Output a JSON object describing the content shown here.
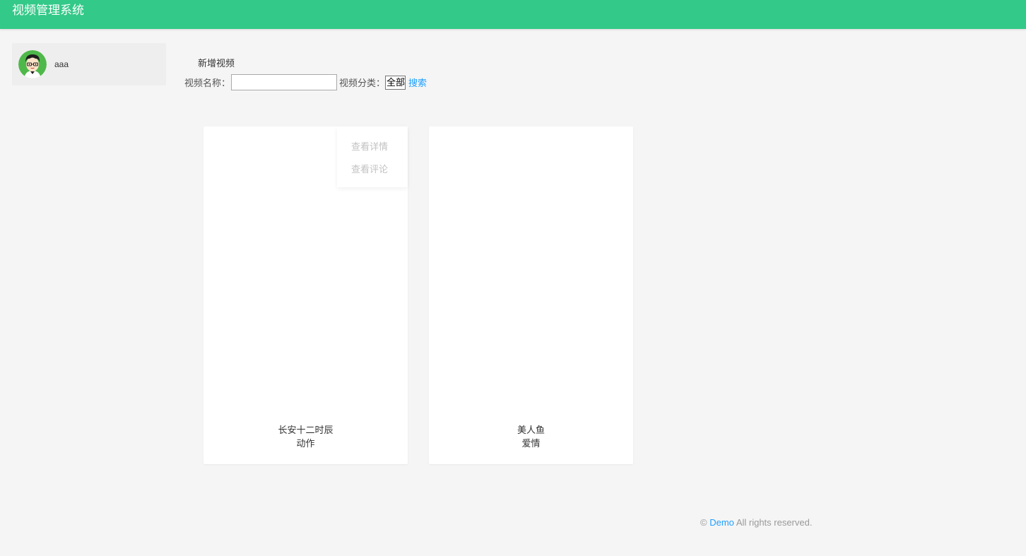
{
  "header": {
    "title": "视频管理系统"
  },
  "user": {
    "name": "aaa",
    "avatar_icon": "cartoon-avatar-icon"
  },
  "toolbar": {
    "add_label": "新增视频",
    "name_label": "视频名称：",
    "name_value": "",
    "category_label": "视频分类：",
    "category_selected": "全部",
    "search_label": "搜索"
  },
  "videos": [
    {
      "title": "长安十二时辰",
      "category": "动作",
      "menu": [
        "查看详情",
        "查看评论"
      ]
    },
    {
      "title": "美人鱼",
      "category": "爱情"
    }
  ],
  "footer": {
    "copyright": "©",
    "brand": "Demo",
    "rights": "All rights reserved."
  },
  "colors": {
    "header": "#33c988",
    "link": "#1e9fff",
    "background": "#f5f5f5"
  }
}
